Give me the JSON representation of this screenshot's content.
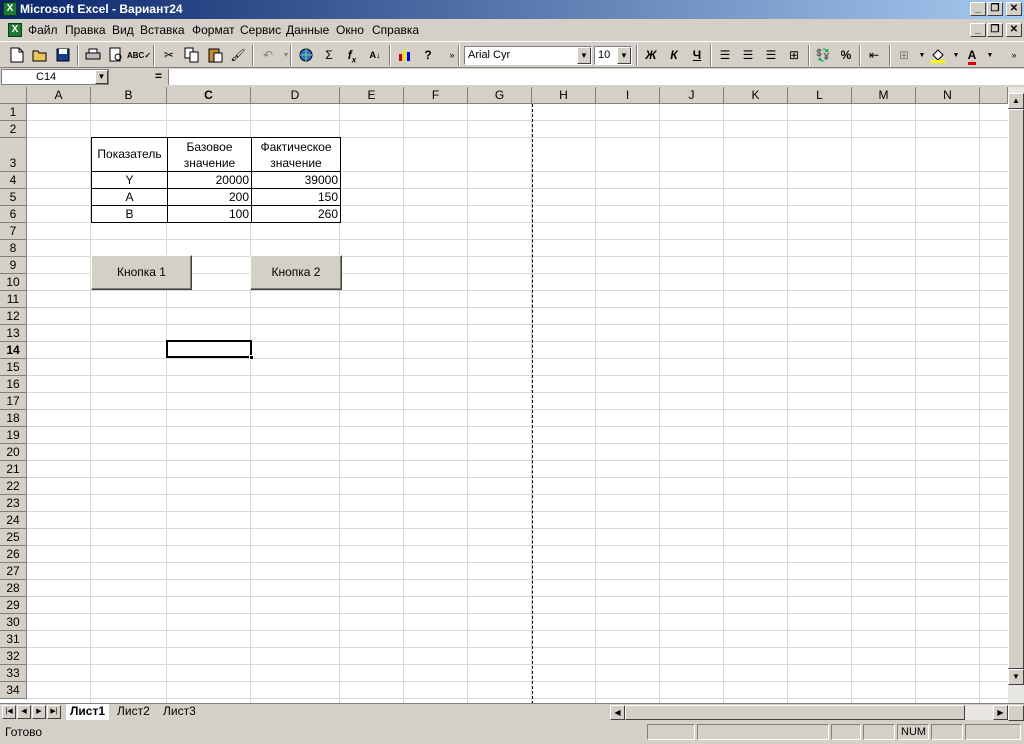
{
  "window": {
    "title": "Microsoft Excel - Вариант24",
    "app_icon": "excel-icon",
    "minimize": "_",
    "restore": "❐",
    "close": "✕"
  },
  "menu": {
    "items": [
      "Файл",
      "Правка",
      "Вид",
      "Вставка",
      "Формат",
      "Сервис",
      "Данные",
      "Окно",
      "Справка"
    ]
  },
  "toolbar": {
    "font_name": "Arial Cyr",
    "font_size": "10",
    "bold_label": "Ж",
    "italic_label": "К",
    "underline_label": "Ч",
    "percent_label": "%",
    "sigma_label": "Σ",
    "fx_label": "f",
    "fx_sub": "x"
  },
  "formula_bar": {
    "name_box": "C14",
    "equals": "=",
    "formula": ""
  },
  "grid": {
    "columns": [
      "A",
      "B",
      "C",
      "D",
      "E",
      "F",
      "G",
      "H",
      "I",
      "J",
      "K",
      "L",
      "M",
      "N"
    ],
    "selected_column": "C",
    "selected_row": "14",
    "rows": [
      "1",
      "2",
      "3",
      "4",
      "5",
      "6",
      "7",
      "8",
      "9",
      "10",
      "11",
      "12",
      "13",
      "14",
      "15",
      "16",
      "17",
      "18",
      "19",
      "20",
      "21",
      "22",
      "23",
      "24",
      "25",
      "26",
      "27",
      "28",
      "29",
      "30",
      "31",
      "32",
      "33",
      "34"
    ]
  },
  "table": {
    "headers": [
      "Показатель",
      "Базовое значение",
      "Фактическое значение"
    ],
    "header_lines": [
      [
        "Показатель"
      ],
      [
        "Базовое",
        "значение"
      ],
      [
        "Фактическое",
        "значение"
      ]
    ],
    "rows": [
      [
        "Y",
        "20000",
        "39000"
      ],
      [
        "A",
        "200",
        "150"
      ],
      [
        "B",
        "100",
        "260"
      ]
    ]
  },
  "sheet_buttons": {
    "button1": "Кнопка 1",
    "button2": "Кнопка 2"
  },
  "sheets": {
    "tabs": [
      "Лист1",
      "Лист2",
      "Лист3"
    ],
    "active": "Лист1"
  },
  "status": {
    "text": "Готово",
    "num": "NUM"
  }
}
